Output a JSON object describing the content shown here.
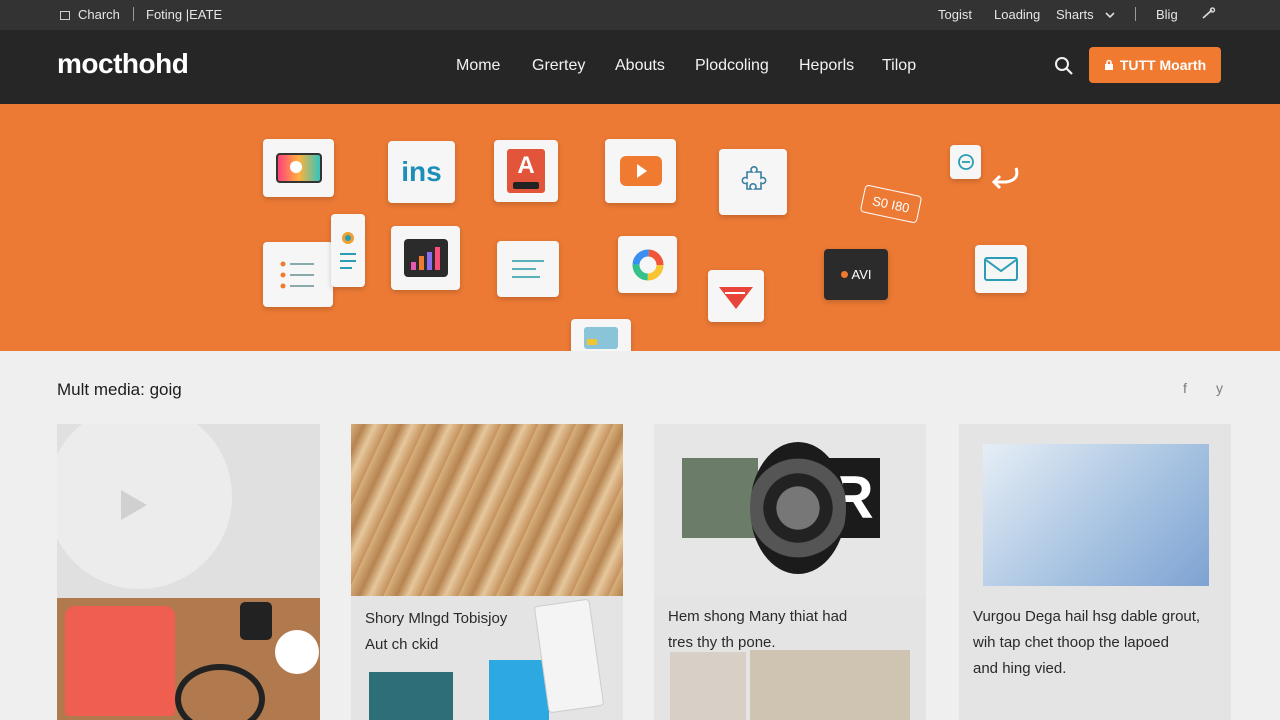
{
  "topbar": {
    "left": [
      "Charch",
      "Foting |EATE"
    ],
    "right": [
      "Togist",
      "Loading",
      "Sharts",
      "Blig"
    ]
  },
  "nav": {
    "logo": "mocthohd",
    "links": [
      "Mome",
      "Grertey",
      "Abouts",
      "Plodcoling",
      "Heporls",
      "Tilop"
    ],
    "cta_label": "TUTT Moarth"
  },
  "hero": {
    "tile_text": {
      "ins": "ins",
      "letter_a": "A",
      "price_tag": "S0 I80",
      "dark_card": "AVI"
    }
  },
  "section": {
    "title": "Mult media: goig",
    "social": [
      "f",
      "y"
    ]
  },
  "cards": [
    {
      "lines": []
    },
    {
      "lines": [
        "Shory Mlngd Tobisjoy",
        "Aut ch ckid"
      ]
    },
    {
      "lines": [
        "Hem shong Many thiat had",
        "tres thy th pone."
      ]
    },
    {
      "lines": [
        "Vurgou Dega hail hsg dable grout,",
        "wih tap chet thoop the lapoed",
        "and hing vied."
      ]
    }
  ],
  "colors": {
    "accent": "#ec7a35",
    "nav_bg": "#262626",
    "topbar_bg": "#333333",
    "page_bg": "#efefef"
  }
}
